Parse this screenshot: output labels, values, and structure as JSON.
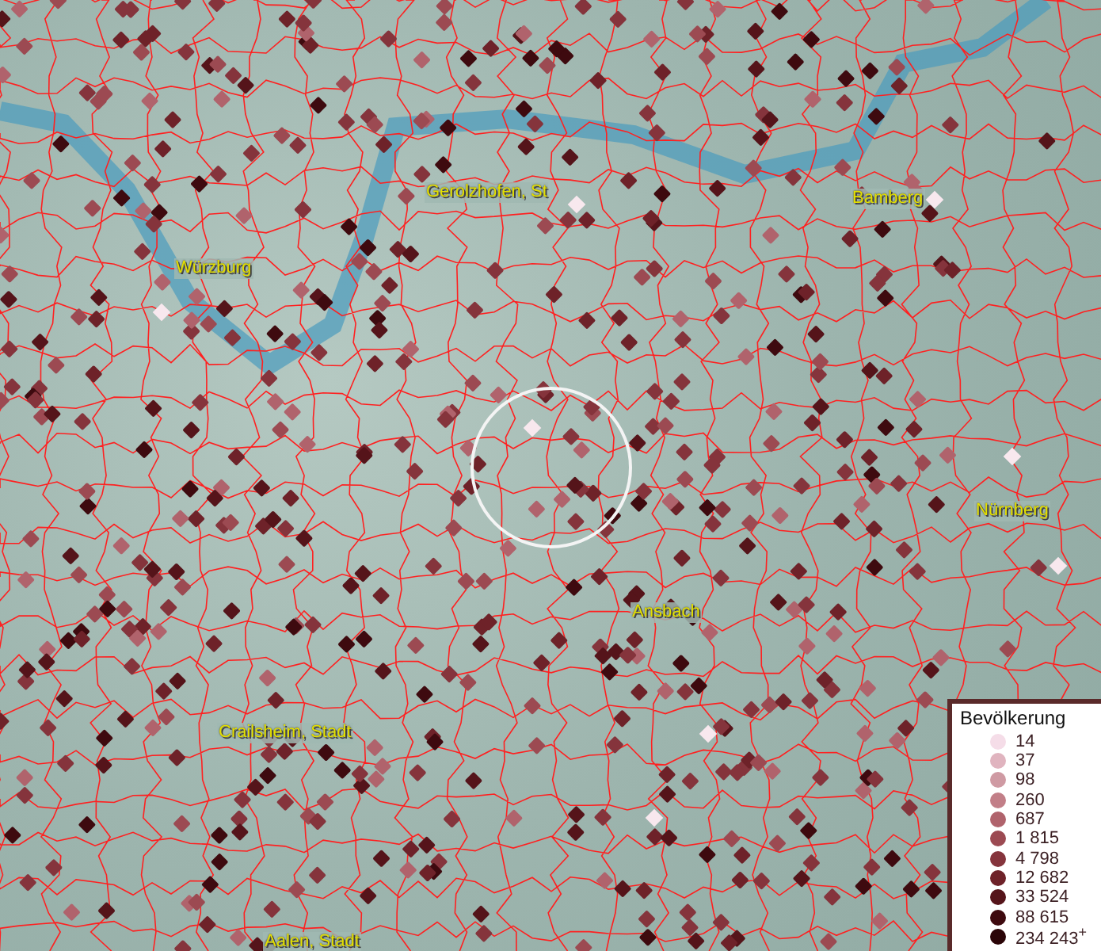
{
  "map": {
    "places": [
      {
        "name": "Gerolzhofen, St",
        "kind": "town"
      },
      {
        "name": "Bamberg",
        "kind": "town"
      },
      {
        "name": "Würzburg",
        "kind": "town"
      },
      {
        "name": "Nürnberg",
        "kind": "town"
      },
      {
        "name": "Ansbach",
        "kind": "town"
      },
      {
        "name": "Crailsheim, Stadt",
        "kind": "town"
      },
      {
        "name": "Aalen, Stadt",
        "kind": "town"
      }
    ]
  },
  "legend": {
    "title": "Bevölkerung",
    "items": [
      {
        "label": "14",
        "color": "#f5dde8"
      },
      {
        "label": "37",
        "color": "#e0b4bf"
      },
      {
        "label": "98",
        "color": "#cf9aa3"
      },
      {
        "label": "260",
        "color": "#c27f88"
      },
      {
        "label": "687",
        "color": "#b0636c"
      },
      {
        "label": "1 815",
        "color": "#9c4a52"
      },
      {
        "label": "4 798",
        "color": "#85343c"
      },
      {
        "label": "12 682",
        "color": "#6e2229"
      },
      {
        "label": "33 524",
        "color": "#55141a"
      },
      {
        "label": "88 615",
        "color": "#3e0a0f"
      },
      {
        "label": "234 243$^{+}$",
        "color": "#2a0407"
      }
    ]
  }
}
